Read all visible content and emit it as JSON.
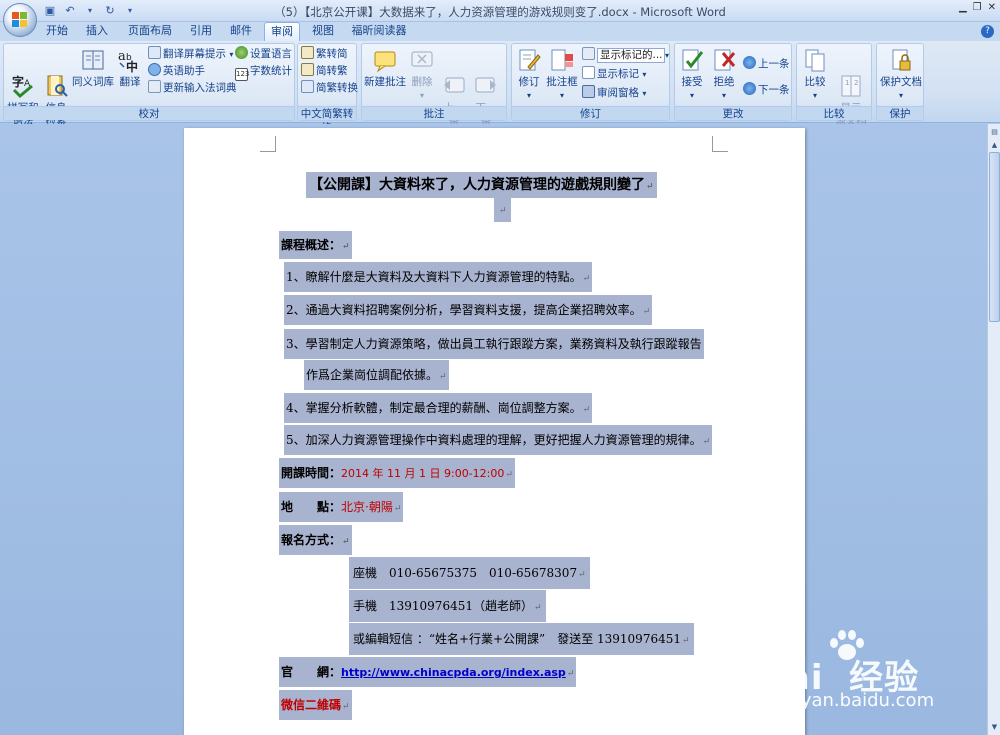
{
  "window": {
    "title": "（5）【北京公开课】大数据来了，人力资源管理的游戏规则变了.docx - Microsoft Word"
  },
  "tabs": [
    "开始",
    "插入",
    "页面布局",
    "引用",
    "邮件",
    "审阅",
    "视图",
    "福昕阅读器"
  ],
  "active_tab": "审阅",
  "ribbon": {
    "proofing": {
      "label": "校对",
      "spelling": "拼写和\n语法",
      "research": "信息\n检索",
      "thesaurus": "同义词库",
      "translate": "翻译",
      "translate_tip": "翻译屏幕提示",
      "english_assistant": "英语助手",
      "update_ime": "更新输入法词典",
      "set_language": "设置语言",
      "word_count": "字数统计"
    },
    "chinese_conv": {
      "label": "中文简繁转换",
      "trad_to_simp": "繁转简",
      "simp_to_trad": "简转繁",
      "convert": "简繁转换"
    },
    "comments": {
      "label": "批注",
      "new": "新建批注",
      "delete": "删除",
      "previous": "上一\n条",
      "next": "下一\n条"
    },
    "tracking": {
      "label": "修订",
      "track": "修订",
      "balloons": "批注框",
      "display_select": "显示标记的...",
      "show_markup": "显示标记",
      "reviewing_pane": "审阅窗格"
    },
    "changes": {
      "label": "更改",
      "accept": "接受",
      "reject": "拒绝",
      "previous": "上一条",
      "next": "下一条"
    },
    "compare": {
      "label": "比较",
      "compare": "比较",
      "show_source": "显示\n源文档"
    },
    "protect": {
      "label": "保护",
      "protect_doc": "保护文档"
    }
  },
  "document": {
    "title": "【公開課】大資料來了，人力資源管理的遊戲規則變了",
    "overview_heading": "課程概述：",
    "items": [
      "1、瞭解什麼是大資料及大資料下人力資源管理的特點。",
      "2、通過大資料招聘案例分析，學習資料支援，提高企業招聘效率。",
      "3、學習制定人力資源策略，做出員工執行跟蹤方案，業務資料及執行跟蹤報告",
      "作爲企業崗位調配依據。",
      "4、掌握分析軟體，制定最合理的薪酬、崗位調整方案。",
      "5、加深人力資源管理操作中資料處理的理解，更好把握人力資源管理的規律。"
    ],
    "time_label": "開課時間：",
    "time_value": "2014 年 11 月 1 日 9:00-12:00",
    "place_label": "地　　點：",
    "place_value": "北京·朝陽",
    "signup_label": "報名方式：",
    "phone": "座機　010-65675375　010-65678307",
    "mobile": "手機　13910976451（趙老師）",
    "sms": "或編輯短信 ：“姓名+行業+公開課”　發送至 13910976451",
    "site_label": "官　　網：",
    "site_url": "http://www.chinacpda.org/index.asp",
    "wechat": "微信二維碼"
  },
  "watermark": {
    "brand": "Bai  经验",
    "url": "jingyan.baidu.com"
  },
  "colors": {
    "highlight": "#a8b3cf",
    "red_text": "#c00000",
    "link": "#0000cc"
  }
}
